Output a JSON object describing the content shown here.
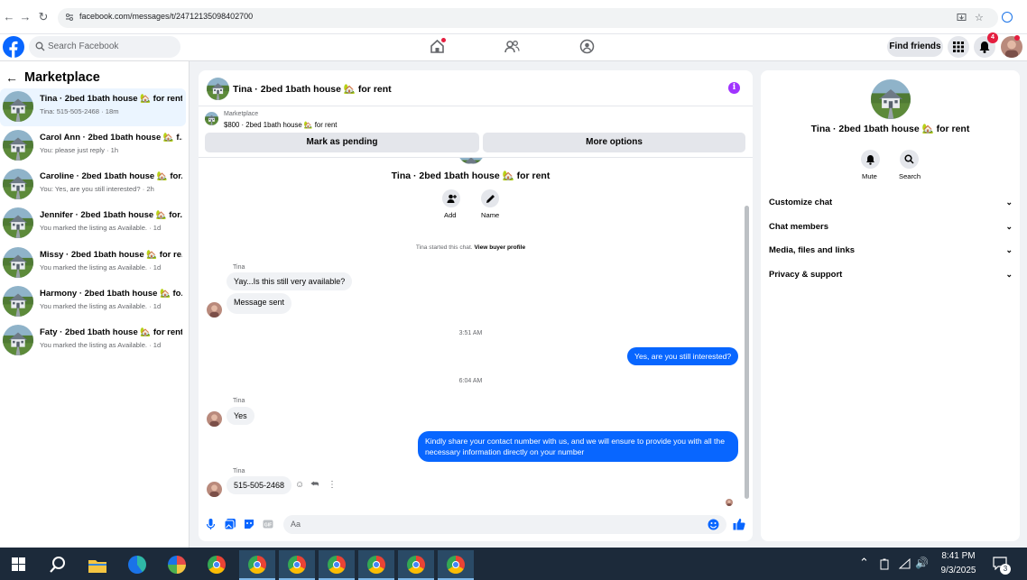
{
  "browser": {
    "url": "facebook.com/messages/t/24712135098402700"
  },
  "header": {
    "search_placeholder": "Search Facebook",
    "find_friends": "Find friends",
    "notif_count": "4"
  },
  "sidebar": {
    "title": "Marketplace",
    "items": [
      {
        "title": "Tina · 2bed 1bath house 🏡 for rent",
        "sub": "Tina: 515-505-2468 · 18m"
      },
      {
        "title": "Carol Ann · 2bed 1bath house 🏡 f...",
        "sub": "You: please just reply · 1h"
      },
      {
        "title": "Caroline · 2bed 1bath house 🏡 for...",
        "sub": "You: Yes, are you still interested? · 2h"
      },
      {
        "title": "Jennifer · 2bed 1bath house 🏡 for...",
        "sub": "You marked the listing as Available. · 1d"
      },
      {
        "title": "Missy · 2bed 1bath house 🏡 for re...",
        "sub": "You marked the listing as Available. · 1d"
      },
      {
        "title": "Harmony · 2bed 1bath house 🏡 fo...",
        "sub": "You marked the listing as Available. · 1d"
      },
      {
        "title": "Faty · 2bed 1bath house 🏡 for rent",
        "sub": "You marked the listing as Available. · 1d"
      }
    ]
  },
  "chat": {
    "title": "Tina · 2bed 1bath house 🏡 for rent",
    "listing_source": "Marketplace",
    "listing_price": "$800 · 2bed 1bath house 🏡 for rent",
    "mark_pending": "Mark as pending",
    "more_options": "More options",
    "intro_title": "Tina · 2bed 1bath house 🏡 for rent",
    "add_label": "Add",
    "name_label": "Name",
    "started_text": "Tina started this chat.",
    "view_profile": "View buyer profile",
    "sender": "Tina",
    "msg1": "Yay...Is this still very available?",
    "msg2": "Message sent",
    "time1": "3:51 AM",
    "out1": "Yes, are you still interested?",
    "time2": "6:04 AM",
    "msg3": "Yes",
    "out2": "Kindly share your contact number with us, and we will ensure to provide you with all the necessary information directly on your number",
    "msg4": "515-505-2468",
    "composer_placeholder": "Aa"
  },
  "details": {
    "title": "Tina · 2bed 1bath house 🏡 for rent",
    "mute": "Mute",
    "search": "Search",
    "sections": [
      "Customize chat",
      "Chat members",
      "Media, files and links",
      "Privacy & support"
    ]
  },
  "taskbar": {
    "time": "8:41 PM",
    "date": "9/3/2025",
    "notif": "3"
  },
  "colors": {
    "fb_blue": "#0866ff",
    "accent_purple": "#a033ff",
    "notif_red": "#e41e3f"
  }
}
